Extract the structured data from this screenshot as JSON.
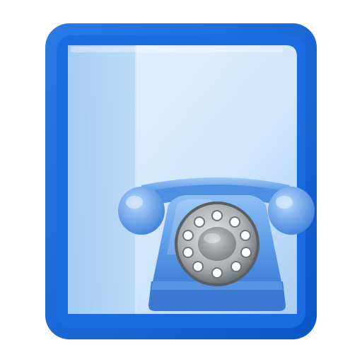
{
  "icon": {
    "name": "phone-book-icon",
    "parts": [
      "address-book-icon",
      "rotary-phone-icon"
    ]
  },
  "colors": {
    "frame_blue": "#1565d8",
    "frame_dark": "#0b4fb8",
    "page_light": "#d6eaff",
    "page_mid": "#a9cdf5",
    "phone_blue": "#6aa8ee",
    "phone_dark": "#3b7fd8",
    "dial_gray": "#8a8f94",
    "dial_light": "#d9dde0"
  }
}
